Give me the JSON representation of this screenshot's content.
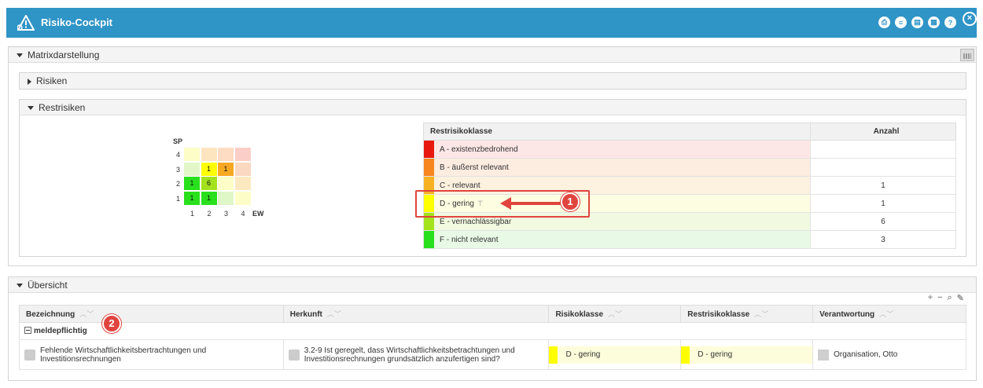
{
  "window": {
    "title": "Risiko-Cockpit",
    "close_glyph": "×"
  },
  "toolbar_icons": [
    {
      "name": "print-icon",
      "glyph": "⎙"
    },
    {
      "name": "list-icon",
      "glyph": "≡"
    },
    {
      "name": "export-icon",
      "glyph": "▤"
    },
    {
      "name": "export-alt-icon",
      "glyph": "▦"
    },
    {
      "name": "help-icon",
      "glyph": "?"
    }
  ],
  "matrix_panel": {
    "title": "Matrixdarstellung"
  },
  "risiken_panel": {
    "title": "Risiken"
  },
  "restrisiken_panel": {
    "title": "Restrisiken"
  },
  "matrix": {
    "y_axis_label": "SP",
    "x_axis_label": "EW",
    "y_ticks": [
      "4",
      "3",
      "2",
      "1"
    ],
    "x_ticks": [
      "1",
      "2",
      "3",
      "4"
    ],
    "rows": [
      [
        {
          "c": "#fdfdc8",
          "v": ""
        },
        {
          "c": "#fde5c0",
          "v": ""
        },
        {
          "c": "#fddcc3",
          "v": ""
        },
        {
          "c": "#fbcfc8",
          "v": ""
        }
      ],
      [
        {
          "c": "#e2f7c8",
          "v": ""
        },
        {
          "c": "#ffff00",
          "v": "1"
        },
        {
          "c": "#f7a823",
          "v": "1"
        },
        {
          "c": "#fbd8c0",
          "v": ""
        }
      ],
      [
        {
          "c": "#29e01d",
          "v": "1"
        },
        {
          "c": "#a3e21d",
          "v": "6"
        },
        {
          "c": "#fdfdc8",
          "v": ""
        },
        {
          "c": "#fde9c0",
          "v": ""
        }
      ],
      [
        {
          "c": "#29e01d",
          "v": "1"
        },
        {
          "c": "#29e01d",
          "v": "1"
        },
        {
          "c": "#dff6c6",
          "v": ""
        },
        {
          "c": "#fdfdc8",
          "v": ""
        }
      ]
    ]
  },
  "legend": {
    "header_class": "Restrisikoklasse",
    "header_count": "Anzahl",
    "rows": [
      {
        "label": "A - existenzbedrohend",
        "color": "#e8190f",
        "bg": "#fde6e6",
        "count": ""
      },
      {
        "label": "B - äußerst relevant",
        "color": "#f7861f",
        "bg": "#fdece0",
        "count": ""
      },
      {
        "label": "C - relevant",
        "color": "#f7b223",
        "bg": "#fdf1df",
        "count": "1"
      },
      {
        "label": "D - gering",
        "color": "#ffff00",
        "bg": "#fdfde1",
        "count": "1",
        "pinned": true
      },
      {
        "label": "E - vernachlässigbar",
        "color": "#a3e21d",
        "bg": "#f1fae0",
        "count": "6"
      },
      {
        "label": "F - nicht relevant",
        "color": "#29e01d",
        "bg": "#e8f9e6",
        "count": "3"
      }
    ],
    "pin_glyph": "⊤"
  },
  "callouts": {
    "one": "1",
    "two": "2"
  },
  "overview": {
    "title": "Übersicht",
    "tools": [
      "+",
      "−",
      "⌕",
      "✎"
    ],
    "columns": [
      "Bezeichnung",
      "Herkunft",
      "Risikoklasse",
      "Restrisikoklasse",
      "Verantwortung"
    ],
    "sort_glyph": "︿﹀",
    "group_label": "meldepflichtig",
    "row": {
      "bezeichnung": "Fehlende Wirtschaftlichkeitsbertrachtungen und Investitionsrechnungen",
      "herkunft": "3.2-9 Ist geregelt, dass Wirtschaftlichkeitsbetrachtungen und Investitionsrechnungen grundsätzlich anzufertigen sind?",
      "risikoklasse": "D - gering",
      "restrisikoklasse": "D - gering",
      "verantwortung": "Organisation, Otto"
    }
  }
}
